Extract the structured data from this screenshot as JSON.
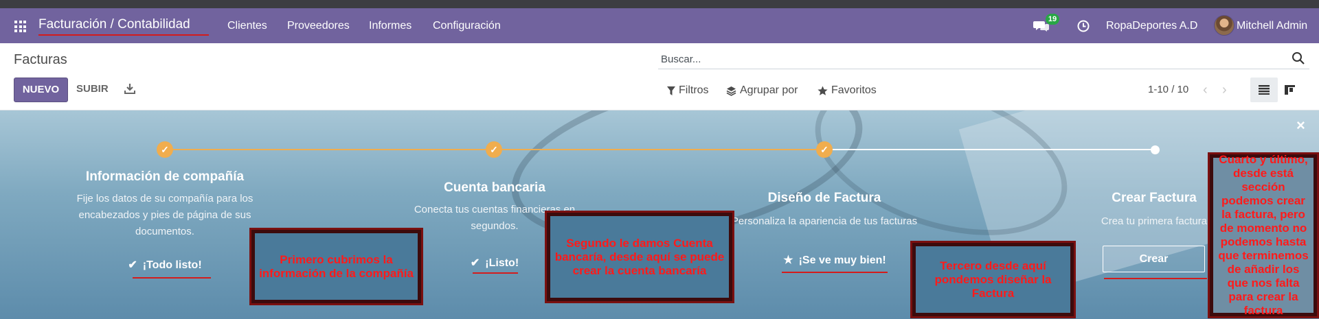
{
  "navbar": {
    "brand": "Facturación / Contabilidad",
    "menu": [
      "Clientes",
      "Proveedores",
      "Informes",
      "Configuración"
    ],
    "messages_count": "19",
    "company": "RopaDeportes A.D",
    "user": "Mitchell Admin",
    "bg_color": "#71639e"
  },
  "control": {
    "title": "Facturas",
    "search_placeholder": "Buscar...",
    "new_label": "NUEVO",
    "upload_label": "SUBIR",
    "filters_label": "Filtros",
    "group_by_label": "Agrupar por",
    "favorites_label": "Favoritos",
    "pager": "1-10 / 10"
  },
  "onboarding": {
    "steps": [
      {
        "title": "Información de compañía",
        "desc": "Fije los datos de su compañía para los encabezados y pies de página de sus documentos.",
        "link": "¡Todo listo!",
        "done": true
      },
      {
        "title": "Cuenta bancaria",
        "desc": "Conecta tus cuentas financieras en segundos.",
        "link": "¡Listo!",
        "done": true
      },
      {
        "title": "Diseño de Factura",
        "desc": "Personaliza la apariencia de tus facturas",
        "link": "¡Se ve muy bien!",
        "done": true
      },
      {
        "title": "Crear Factura",
        "desc": "Crea tu primera factura",
        "button": "Crear",
        "done": false
      }
    ],
    "accent": "#f0ad4e"
  },
  "annotations": {
    "note1": "Primero cubrimos la información de la compañía",
    "note2": "Segundo le damos Cuenta bancaría, desde aquí se puede crear la cuenta bancaría",
    "note3": "Tercero desde aquí pondemos diseñar la Factura",
    "note4": "Cuarto y último, desde está sección podemos crear la factura, pero de momento no podemos hasta que terminemos de añadir los que nos falta para crear la factura",
    "color": "#ff1a1a"
  }
}
